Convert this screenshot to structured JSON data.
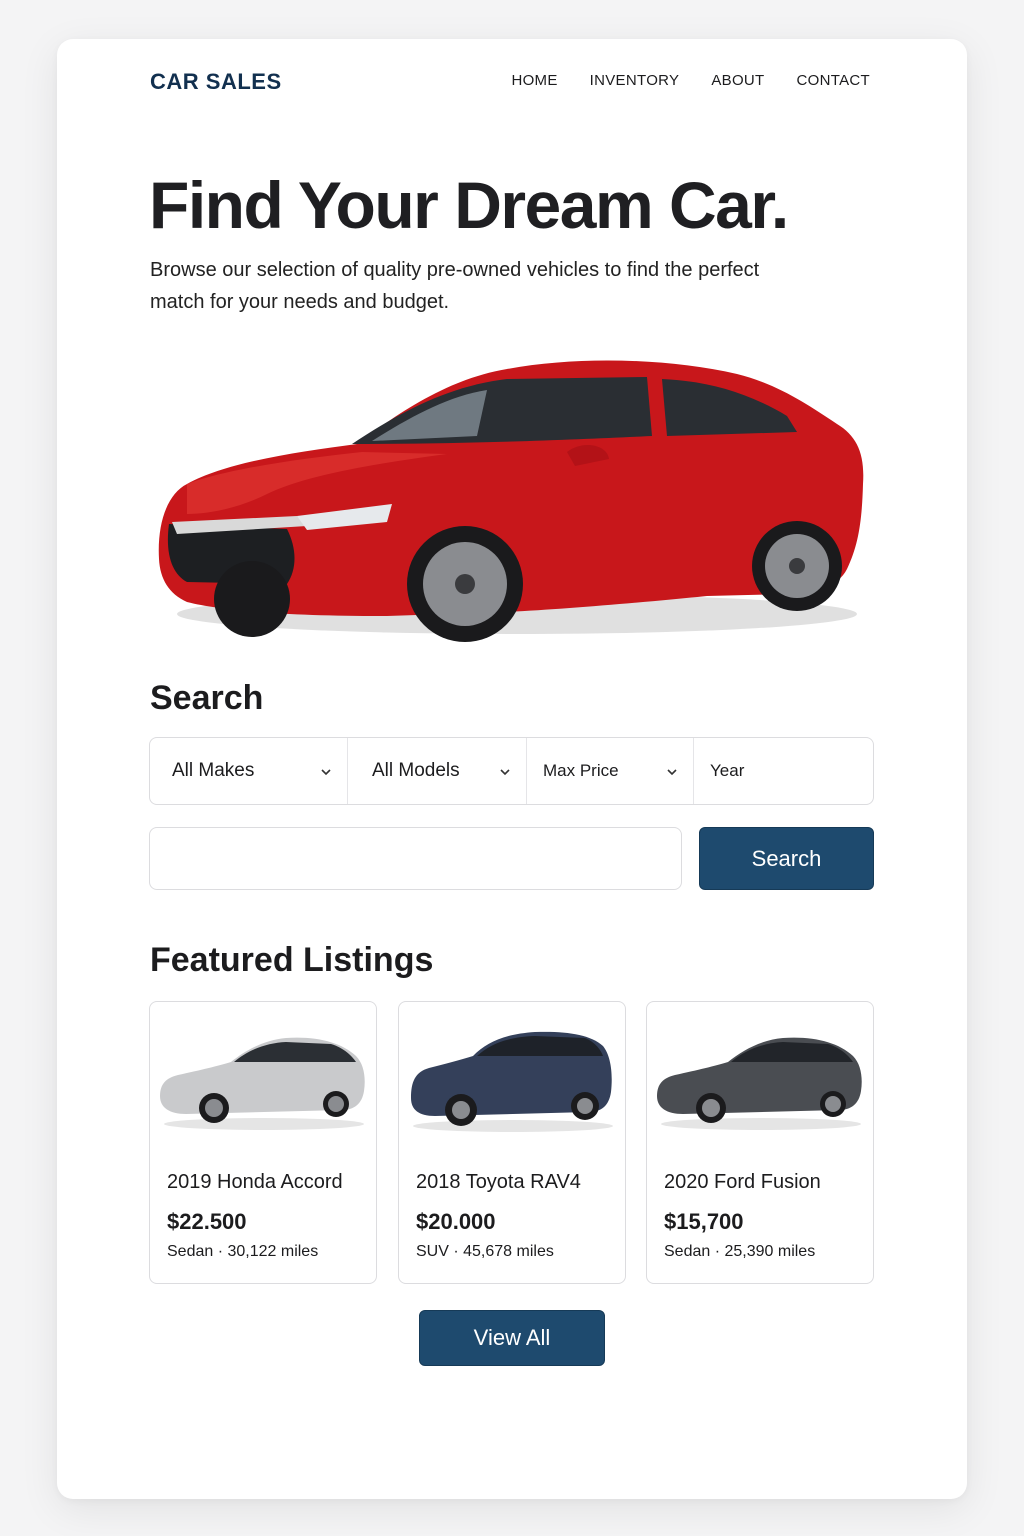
{
  "nav": {
    "brand": "CAR SALES",
    "links": [
      "HOME",
      "INVENTORY",
      "ABOUT",
      "CONTACT"
    ]
  },
  "hero": {
    "title": "Find Your Dream Car.",
    "subtitle": "Browse our selection of quality pre-owned vehicles to find the perfect match for your needs and budget.",
    "car_color": "#c8171b"
  },
  "search": {
    "title": "Search",
    "filters": [
      "All Makes",
      "All Models",
      "Max Price",
      "Year"
    ],
    "input_value": "",
    "button_label": "Search"
  },
  "featured": {
    "title": "Featured Listings",
    "listings": [
      {
        "name": "2019 Honda Accord",
        "price": "$22.500",
        "meta": "Sedan · 30,122 miles",
        "color": "#c9cacc"
      },
      {
        "name": "2018 Toyota RAV4",
        "price": "$20.000",
        "meta": "SUV · 45,678 miles",
        "color": "#34405a"
      },
      {
        "name": "2020 Ford Fusion",
        "price": "$15,700",
        "meta": "Sedan · 25,390 miles",
        "color": "#4a4d52"
      }
    ],
    "view_all_label": "View All"
  },
  "colors": {
    "brand": "#12304f",
    "button": "#1e4a6e"
  }
}
